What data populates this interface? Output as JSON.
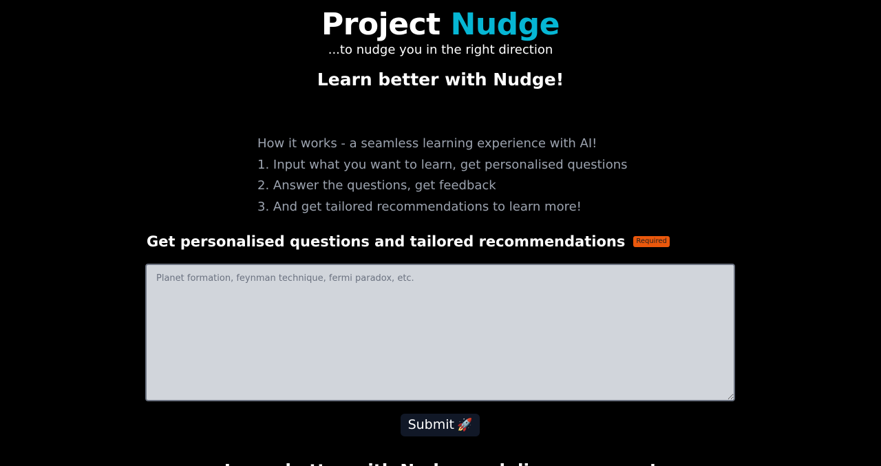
{
  "header": {
    "title_part1": "Project ",
    "title_part2": "Nudge",
    "tagline": "...to nudge you in the right direction",
    "subheading": "Learn better with Nudge!"
  },
  "how_it_works": {
    "intro": "How it works - a seamless learning experience with AI!",
    "steps": [
      "1. Input what you want to learn, get personalised questions",
      "2. Answer the questions, get feedback",
      "3. And get tailored recommendations to learn more!"
    ]
  },
  "form": {
    "label": "Get personalised questions and tailored recommendations",
    "required_badge": "Required",
    "topic_placeholder": "Planet formation, feynman technique, fermi paradox, etc.",
    "topic_value": "",
    "submit_label": "Submit",
    "submit_icon": "🚀"
  },
  "below_fold": {
    "heading": "Learn better with Nudge and discover more!"
  },
  "colors": {
    "background": "#000000",
    "accent": "#06b6d4",
    "muted_text": "#9ca3af",
    "badge": "#ea580c",
    "textarea_bg": "#d1d5db",
    "button_bg": "#111827"
  }
}
